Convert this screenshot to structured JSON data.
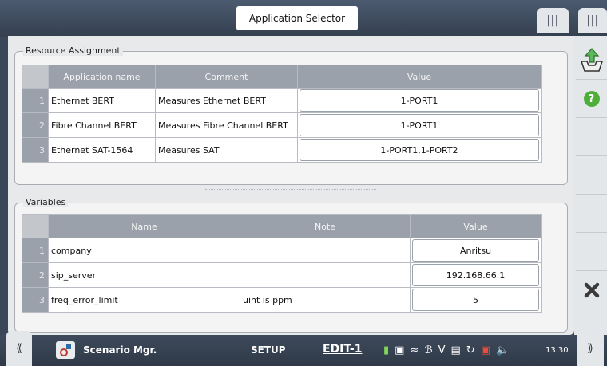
{
  "window": {
    "title": "Application Selector"
  },
  "resource_assignment": {
    "title": "Resource Assignment",
    "columns": [
      "Application name",
      "Comment",
      "Value"
    ],
    "rows": [
      {
        "num": "1",
        "name": "Ethernet BERT",
        "comment": "Measures Ethernet BERT",
        "value": "1-PORT1"
      },
      {
        "num": "2",
        "name": "Fibre Channel BERT",
        "comment": "Measures Fibre Channel BERT",
        "value": "1-PORT1"
      },
      {
        "num": "3",
        "name": "Ethernet SAT-1564",
        "comment": "Measures SAT",
        "value": "1-PORT1,1-PORT2"
      }
    ]
  },
  "variables": {
    "title": "Variables",
    "columns": [
      "Name",
      "Note",
      "Value"
    ],
    "rows": [
      {
        "num": "1",
        "name": "company",
        "note": "",
        "value": "Anritsu"
      },
      {
        "num": "2",
        "name": "sip_server",
        "note": "",
        "value": "192.168.66.1"
      },
      {
        "num": "3",
        "name": "freq_error_limit",
        "note": "uint is ppm",
        "value": "5"
      }
    ]
  },
  "bottom_bar": {
    "app_name": "Scenario Mgr.",
    "mode": "SETUP",
    "edit": "EDIT-1",
    "time": "13 30"
  },
  "right_rail": {
    "help_label": "?"
  },
  "colors": {
    "help_green": "#4fae3a",
    "accent_tab": "#e4e7ea"
  }
}
